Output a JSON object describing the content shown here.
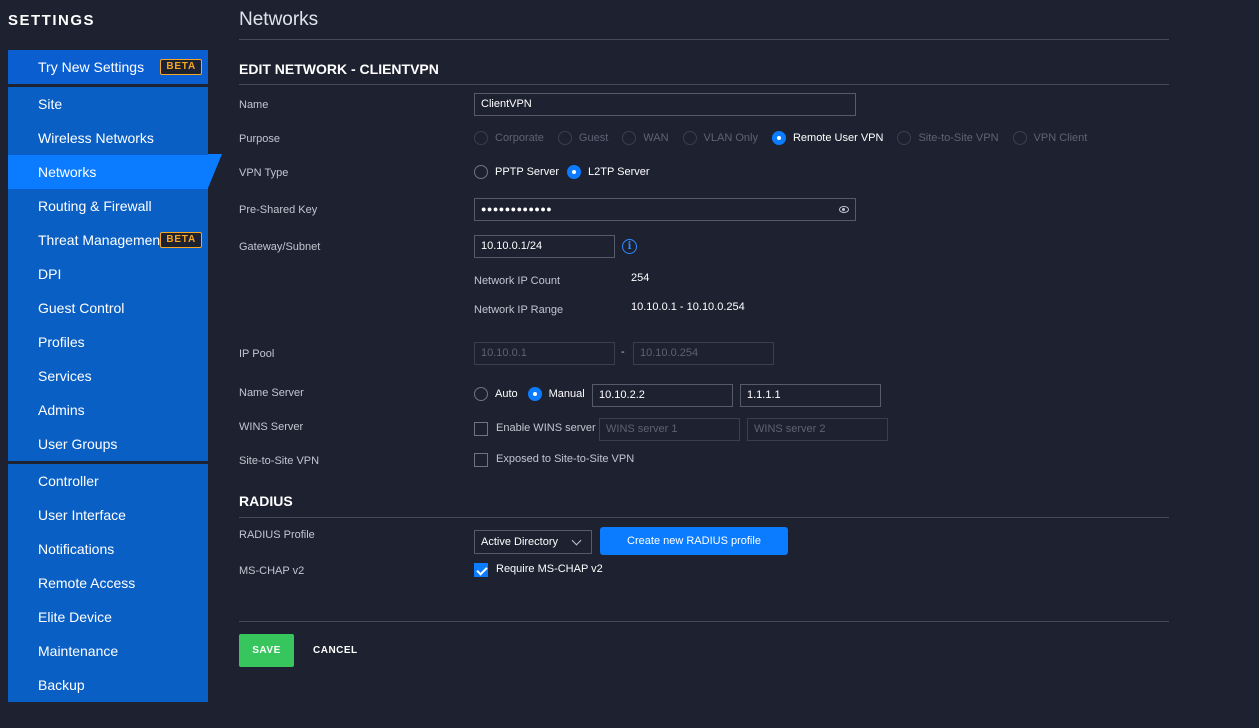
{
  "sidebar": {
    "title": "SETTINGS",
    "groups": [
      [
        {
          "label": "Try New Settings",
          "badge": "BETA"
        }
      ],
      [
        {
          "label": "Site"
        },
        {
          "label": "Wireless Networks"
        },
        {
          "label": "Networks",
          "active": true
        },
        {
          "label": "Routing & Firewall"
        },
        {
          "label": "Threat Management",
          "badge": "BETA"
        },
        {
          "label": "DPI"
        },
        {
          "label": "Guest Control"
        },
        {
          "label": "Profiles"
        },
        {
          "label": "Services"
        },
        {
          "label": "Admins"
        },
        {
          "label": "User Groups"
        }
      ],
      [
        {
          "label": "Controller"
        },
        {
          "label": "User Interface"
        },
        {
          "label": "Notifications"
        },
        {
          "label": "Remote Access"
        },
        {
          "label": "Elite Device"
        },
        {
          "label": "Maintenance"
        },
        {
          "label": "Backup"
        }
      ]
    ]
  },
  "page": {
    "title": "Networks",
    "section_title": "EDIT NETWORK - CLIENTVPN",
    "radius_title": "RADIUS"
  },
  "form": {
    "name": {
      "label": "Name",
      "value": "ClientVPN"
    },
    "purpose": {
      "label": "Purpose",
      "options": [
        "Corporate",
        "Guest",
        "WAN",
        "VLAN Only",
        "Remote User VPN",
        "Site-to-Site VPN",
        "VPN Client"
      ],
      "selected": "Remote User VPN"
    },
    "vpn_type": {
      "label": "VPN Type",
      "options": [
        "PPTP Server",
        "L2TP Server"
      ],
      "selected": "L2TP Server"
    },
    "psk": {
      "label": "Pre-Shared Key",
      "value": "●●●●●●●●●●●●"
    },
    "gateway": {
      "label": "Gateway/Subnet",
      "value": "10.10.0.1/24"
    },
    "ip_count": {
      "label": "Network IP Count",
      "value": "254"
    },
    "ip_range": {
      "label": "Network IP Range",
      "value": "10.10.0.1 - 10.10.0.254"
    },
    "ip_pool": {
      "label": "IP Pool",
      "start": "10.10.0.1",
      "end": "10.10.0.254",
      "separator": "-"
    },
    "name_server": {
      "label": "Name Server",
      "options": [
        "Auto",
        "Manual"
      ],
      "selected": "Manual",
      "server1": "10.10.2.2",
      "server2": "1.1.1.1"
    },
    "wins": {
      "label": "WINS Server",
      "checkbox_label": "Enable WINS server",
      "checked": false,
      "placeholder1": "WINS server 1",
      "placeholder2": "WINS server 2"
    },
    "s2s": {
      "label": "Site-to-Site VPN",
      "checkbox_label": "Exposed to Site-to-Site VPN",
      "checked": false
    },
    "radius_profile": {
      "label": "RADIUS Profile",
      "value": "Active Directory",
      "create_button": "Create new RADIUS profile"
    },
    "mschap": {
      "label": "MS-CHAP v2",
      "checkbox_label": "Require MS-CHAP v2",
      "checked": true
    }
  },
  "actions": {
    "save": "SAVE",
    "cancel": "CANCEL"
  },
  "colors": {
    "accent": "#0b7cff",
    "sidebar": "#0a5fc4",
    "save": "#37c55e",
    "beta": "#f6a623",
    "background": "#1e2130"
  }
}
